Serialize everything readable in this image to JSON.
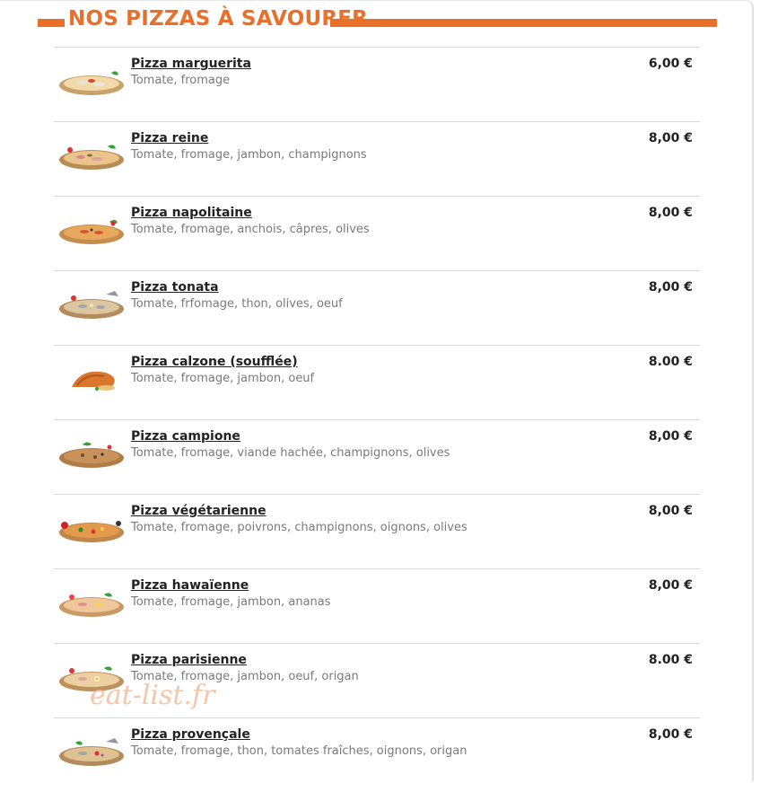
{
  "section": {
    "title": "NOS PIZZAS À SAVOURER"
  },
  "colors": {
    "accent": "#e8702a",
    "text": "#222222",
    "muted": "#7a7a7a"
  },
  "items": [
    {
      "name": "Pizza marguerita",
      "description": "Tomate, fromage",
      "price": "6,00 €"
    },
    {
      "name": "Pizza reine",
      "description": "Tomate, fromage, jambon, champignons",
      "price": "8,00 €"
    },
    {
      "name": "Pizza napolitaine",
      "description": "Tomate, fromage, anchois, câpres, olives",
      "price": "8,00 €"
    },
    {
      "name": "Pizza tonata",
      "description": "Tomate, frfomage, thon, olives, oeuf",
      "price": "8,00 €"
    },
    {
      "name": "Pizza calzone (soufflée)",
      "description": "Tomate, fromage, jambon, oeuf",
      "price": "8.00 €"
    },
    {
      "name": "Pizza campione",
      "description": "Tomate, fromage, viande hachée, champignons, olives",
      "price": "8,00 €"
    },
    {
      "name": "Pizza végétarienne",
      "description": "Tomate, fromage, poivrons, champignons, oignons, olives",
      "price": "8,00 €"
    },
    {
      "name": "Pizza hawaïenne",
      "description": "Tomate, fromage, jambon, ananas",
      "price": "8,00 €"
    },
    {
      "name": "Pizza parisienne",
      "description": "Tomate, fromage, jambon, oeuf, origan",
      "price": "8.00 €"
    },
    {
      "name": "Pizza provençale",
      "description": "Tomate, fromage, thon, tomates fraîches, oignons, origan",
      "price": "8,00 €"
    }
  ],
  "watermark": "eat-list.fr"
}
